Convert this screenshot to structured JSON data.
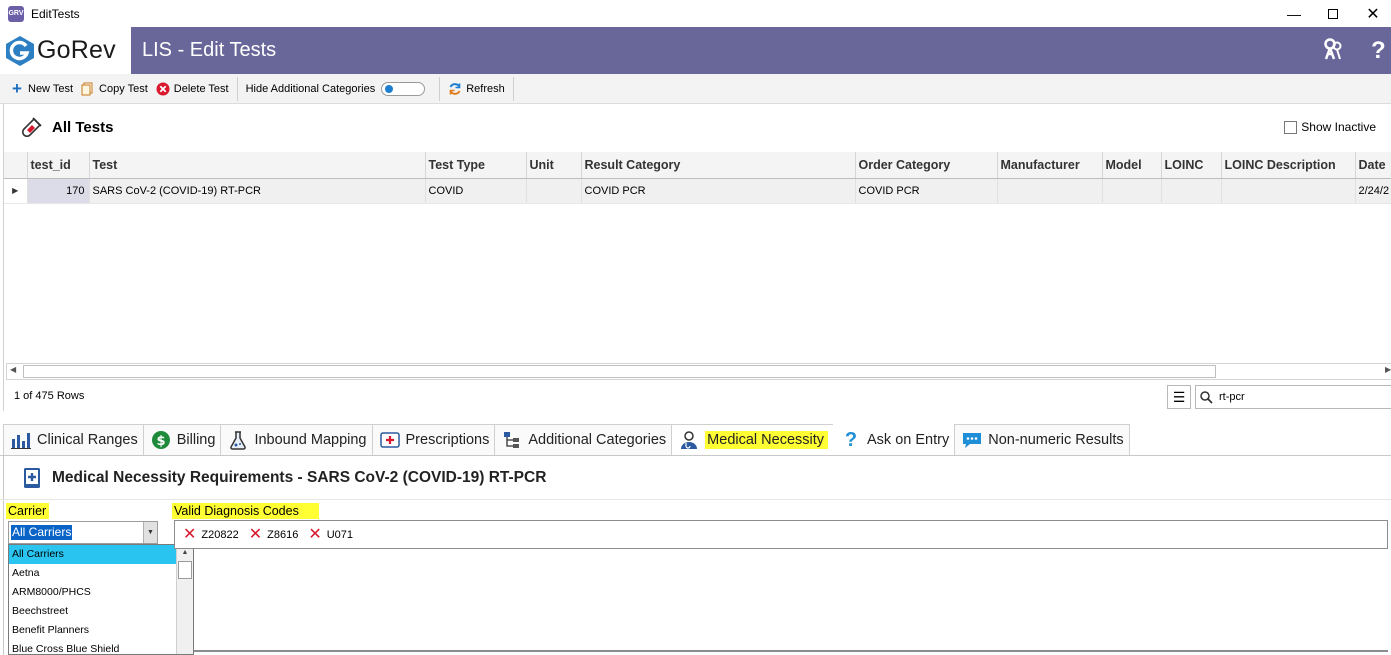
{
  "window": {
    "title": "EditTests",
    "app_badge": "GRV"
  },
  "header": {
    "logo_text": "GoRev",
    "title": "LIS - Edit Tests",
    "help_glyph": "?"
  },
  "toolbar": {
    "new_test": "New Test",
    "copy_test": "Copy Test",
    "delete_test": "Delete Test",
    "hide_categories": "Hide Additional Categories",
    "refresh": "Refresh"
  },
  "tests_section": {
    "title": "All Tests",
    "show_inactive": "Show Inactive",
    "columns": [
      "test_id",
      "Test",
      "Test Type",
      "Unit",
      "Result Category",
      "Order Category",
      "Manufacturer",
      "Model",
      "LOINC",
      "LOINC Description",
      "Date"
    ],
    "rows": [
      [
        "170",
        "SARS CoV-2 (COVID-19) RT-PCR",
        "COVID",
        "",
        "COVID PCR",
        "COVID PCR",
        "",
        "",
        "",
        "",
        "2/24/2"
      ]
    ],
    "row_count": "1 of 475 Rows",
    "search_value": "rt-pcr"
  },
  "tabs": [
    {
      "label": "Clinical Ranges"
    },
    {
      "label": "Billing"
    },
    {
      "label": "Inbound Mapping"
    },
    {
      "label": "Prescriptions"
    },
    {
      "label": "Additional Categories"
    },
    {
      "label": "Medical Necessity"
    },
    {
      "label": "Ask on Entry"
    },
    {
      "label": "Non-numeric Results"
    }
  ],
  "medical_necessity": {
    "title": "Medical Necessity Requirements - SARS CoV-2 (COVID-19) RT-PCR",
    "carrier_label": "Carrier",
    "codes_label": "Valid Diagnosis Codes",
    "carrier_selected": "All Carriers",
    "carrier_options": [
      "All Carriers",
      "Aetna",
      "ARM8000/PHCS",
      "Beechstreet",
      "Benefit Planners",
      "Blue Cross Blue Shield"
    ],
    "codes": [
      "Z20822",
      "Z8616",
      "U071"
    ]
  },
  "colors": {
    "banner": "#69679a",
    "highlight": "#ffff33",
    "selected_option": "#29c5f0",
    "remove_x": "#d8182c"
  }
}
